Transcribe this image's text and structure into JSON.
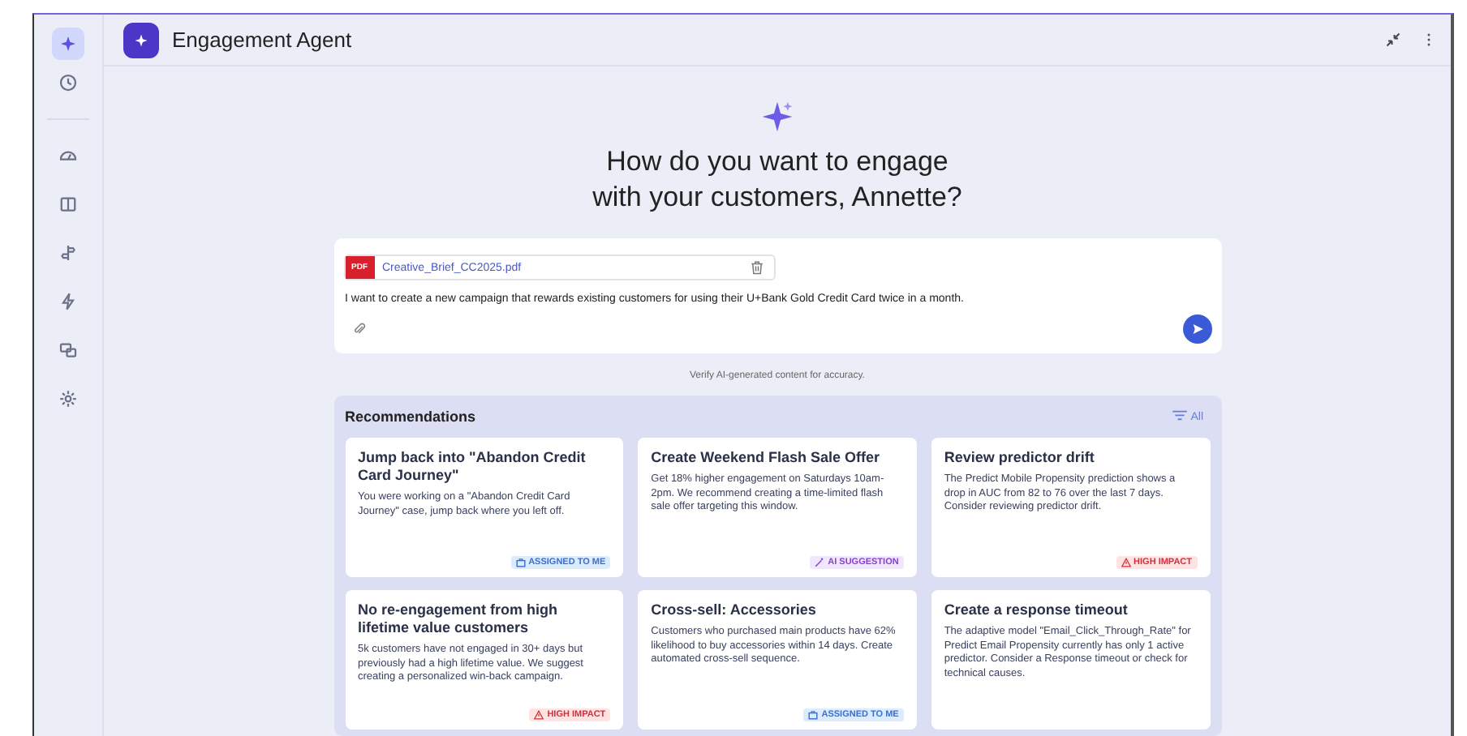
{
  "sidebar": {
    "items": [
      {
        "kind": "sparkle",
        "selected": true
      },
      {
        "kind": "history",
        "selected": false
      },
      {
        "kind": "divider"
      },
      {
        "kind": "gauge",
        "selected": false
      },
      {
        "kind": "book",
        "selected": false
      },
      {
        "kind": "journey",
        "selected": false
      },
      {
        "kind": "bolt",
        "selected": false
      },
      {
        "kind": "devices",
        "selected": false
      },
      {
        "kind": "gear",
        "selected": false
      }
    ]
  },
  "header": {
    "title": "Engagement Agent"
  },
  "hero": {
    "heading_line_1": "How do you want to engage",
    "heading_line_2": "with your customers, Annette?"
  },
  "prompt": {
    "attachment": {
      "type": "PDF",
      "name": "Creative_Brief_CC2025.pdf"
    },
    "value": "I want to create a new campaign that rewards existing customers for using their U+Bank Gold Credit Card twice in a month."
  },
  "disclaimer": "Verify AI-generated content for accuracy.",
  "recommendations": {
    "title": "Recommendations",
    "filter": "All",
    "cards": [
      {
        "title": "Jump back into \"Abandon Credit Card Journey\"",
        "body": "You were working on a \"Abandon Credit Card Journey\" case, jump back where you left off.",
        "badge": {
          "kind": "assigned",
          "label": "ASSIGNED TO ME"
        }
      },
      {
        "title": "Create Weekend Flash Sale Offer",
        "body": "Get 18% higher engagement on Saturdays 10am-2pm. We recommend creating a time-limited flash sale offer targeting this window.",
        "badge": {
          "kind": "ai",
          "label": "AI SUGGESTION"
        }
      },
      {
        "title": "Review predictor drift",
        "body": "The Predict Mobile Propensity prediction shows a drop in AUC from 82 to 76 over the last 7 days. Consider reviewing predictor drift.",
        "badge": {
          "kind": "impact",
          "label": "HIGH IMPACT"
        }
      },
      {
        "title": "No re-engagement from high lifetime value customers",
        "body": "5k customers have not engaged in 30+ days but previously had a high lifetime value. We suggest creating a personalized win-back campaign.",
        "badge": {
          "kind": "impact",
          "label": "HIGH IMPACT"
        }
      },
      {
        "title": "Cross-sell: Accessories",
        "body": "Customers who purchased main products have 62% likelihood to buy accessories within 14 days. Create automated cross-sell sequence.",
        "badge": {
          "kind": "assigned",
          "label": "ASSIGNED TO ME"
        }
      },
      {
        "title": "Create a response timeout",
        "body": "The adaptive model \"Email_Click_Through_Rate\" for Predict Email Propensity currently has only 1 active predictor. Consider a Response timeout or check for technical causes."
      }
    ]
  }
}
